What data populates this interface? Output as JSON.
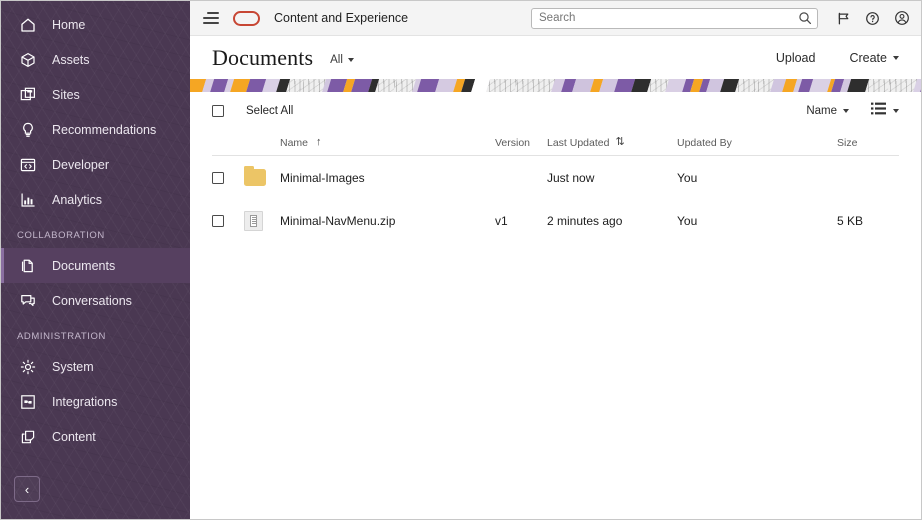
{
  "sidebar": {
    "items": [
      {
        "label": "Home",
        "icon": "home-icon",
        "active": false
      },
      {
        "label": "Assets",
        "icon": "cube-icon",
        "active": false
      },
      {
        "label": "Sites",
        "icon": "sites-icon",
        "active": false
      },
      {
        "label": "Recommendations",
        "icon": "lightbulb-icon",
        "active": false
      },
      {
        "label": "Developer",
        "icon": "code-window-icon",
        "active": false
      },
      {
        "label": "Analytics",
        "icon": "bar-chart-icon",
        "active": false
      }
    ],
    "sections": [
      {
        "label": "COLLABORATION",
        "items": [
          {
            "label": "Documents",
            "icon": "documents-icon",
            "active": true
          },
          {
            "label": "Conversations",
            "icon": "conversations-icon",
            "active": false
          }
        ]
      },
      {
        "label": "ADMINISTRATION",
        "items": [
          {
            "label": "System",
            "icon": "gear-icon",
            "active": false
          },
          {
            "label": "Integrations",
            "icon": "integrations-icon",
            "active": false
          },
          {
            "label": "Content",
            "icon": "content-copy-icon",
            "active": false
          }
        ]
      }
    ],
    "collapse_glyph": "‹",
    "background_color": "#4a3852",
    "active_color": "#564060"
  },
  "topbar": {
    "menu_icon": "hamburger-icon",
    "logo": "oracle-logo",
    "logo_color": "#c74634",
    "app_title": "Content and Experience",
    "search": {
      "placeholder": "Search",
      "value": ""
    },
    "icons": [
      {
        "name": "flag-icon"
      },
      {
        "name": "help-circle-icon"
      },
      {
        "name": "user-account-icon"
      }
    ]
  },
  "title_row": {
    "page_title": "Documents",
    "filter_label": "All",
    "upload_label": "Upload",
    "create_label": "Create"
  },
  "toolbar": {
    "select_all_label": "Select All",
    "sort_label": "Name",
    "view_icon": "list-view-icon"
  },
  "table": {
    "columns": [
      {
        "label": "Name",
        "sort_glyph": "↑"
      },
      {
        "label": "Version",
        "sort_glyph": ""
      },
      {
        "label": "Last Updated",
        "sort_glyph": "⇅"
      },
      {
        "label": "Updated By",
        "sort_glyph": ""
      },
      {
        "label": "Size",
        "sort_glyph": ""
      }
    ],
    "rows": [
      {
        "icon": "folder-icon",
        "name": "Minimal-Images",
        "version": "",
        "last_updated": "Just now",
        "updated_by": "You",
        "size": ""
      },
      {
        "icon": "zip-file-icon",
        "name": "Minimal-NavMenu.zip",
        "version": "v1",
        "last_updated": "2 minutes ago",
        "updated_by": "You",
        "size": "5 KB"
      }
    ]
  },
  "banner": {
    "colors": [
      "#f5a623",
      "#7d5ba6",
      "#cfc3dd",
      "#2e2e2e",
      "#ffffff",
      "#b9b9b9"
    ]
  }
}
